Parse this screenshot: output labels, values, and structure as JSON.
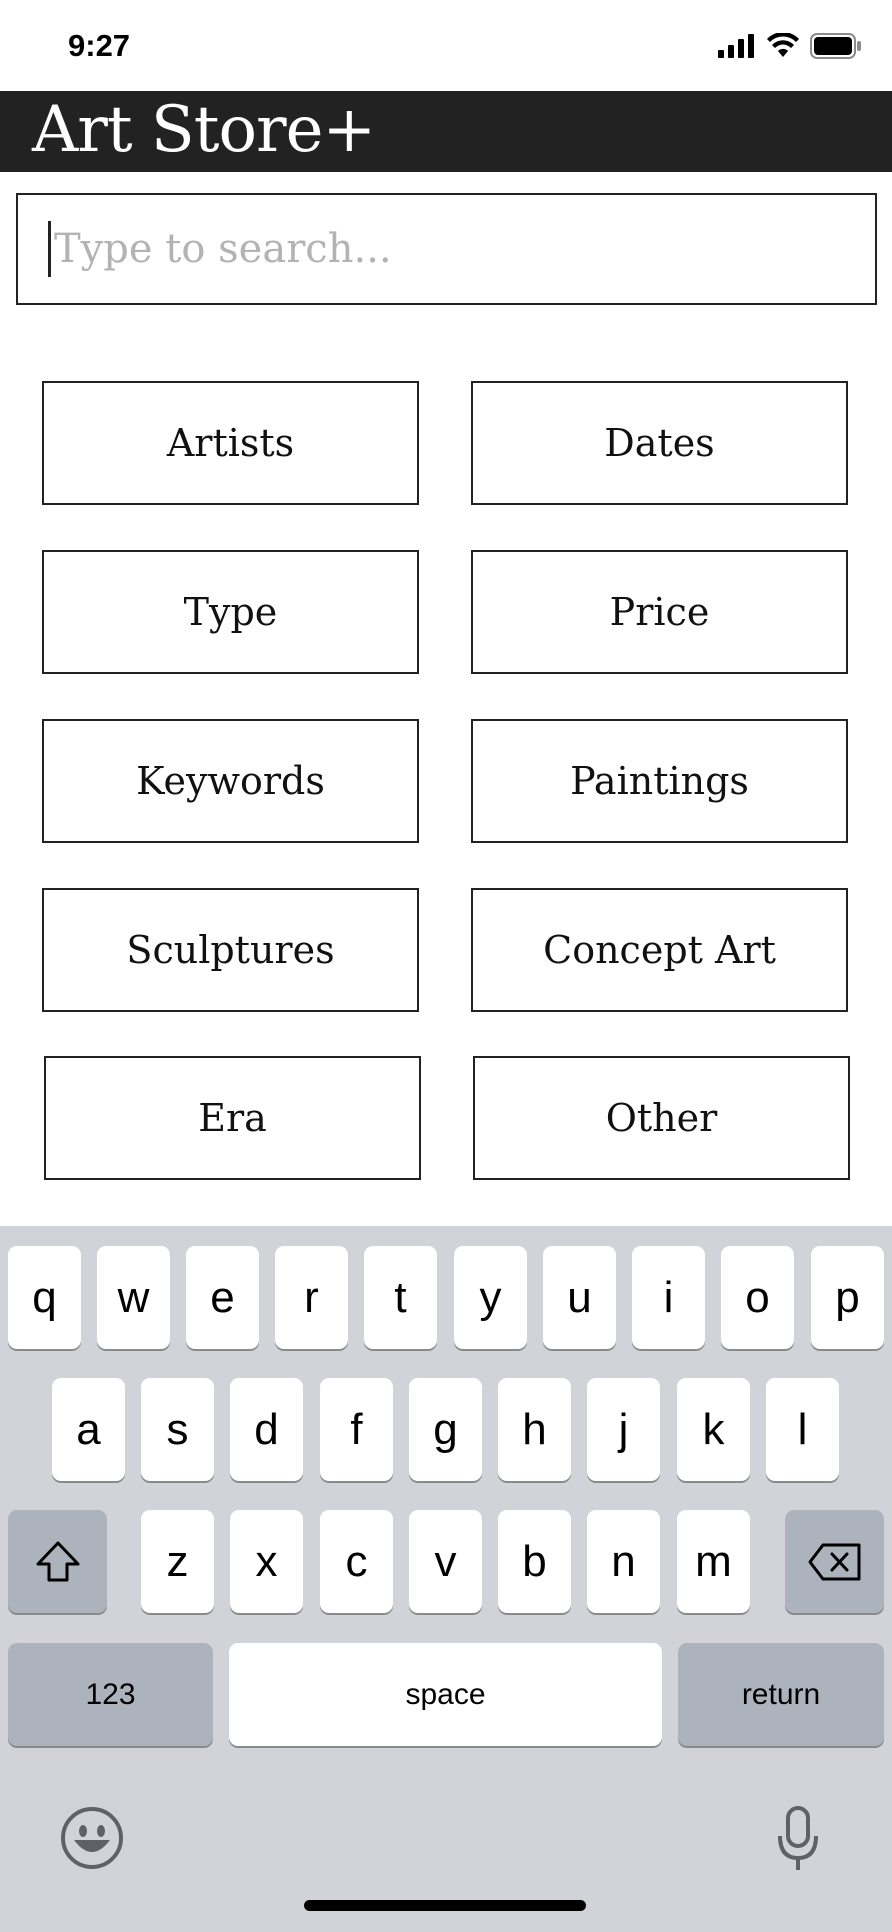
{
  "status": {
    "time": "9:27"
  },
  "header": {
    "title": "Art Store+"
  },
  "search": {
    "placeholder": "Type to search...",
    "value": ""
  },
  "categories": [
    {
      "label": "Artists"
    },
    {
      "label": "Dates"
    },
    {
      "label": "Type"
    },
    {
      "label": "Price"
    },
    {
      "label": "Keywords"
    },
    {
      "label": "Paintings"
    },
    {
      "label": "Sculptures"
    },
    {
      "label": "Concept Art"
    },
    {
      "label": "Era"
    },
    {
      "label": "Other"
    }
  ],
  "keyboard": {
    "row1": [
      "q",
      "w",
      "e",
      "r",
      "t",
      "y",
      "u",
      "i",
      "o",
      "p"
    ],
    "row2": [
      "a",
      "s",
      "d",
      "f",
      "g",
      "h",
      "j",
      "k",
      "l"
    ],
    "row3": [
      "z",
      "x",
      "c",
      "v",
      "b",
      "n",
      "m"
    ],
    "numbers_label": "123",
    "space_label": "space",
    "return_label": "return",
    "icons": {
      "shift": "shift-icon",
      "delete": "delete-icon",
      "emoji": "emoji-icon",
      "mic": "microphone-icon"
    }
  },
  "colors": {
    "header_bg": "#222222",
    "keyboard_bg": "#d1d3d9",
    "key_dark": "#adb3bd",
    "placeholder": "#b3b3b3"
  }
}
